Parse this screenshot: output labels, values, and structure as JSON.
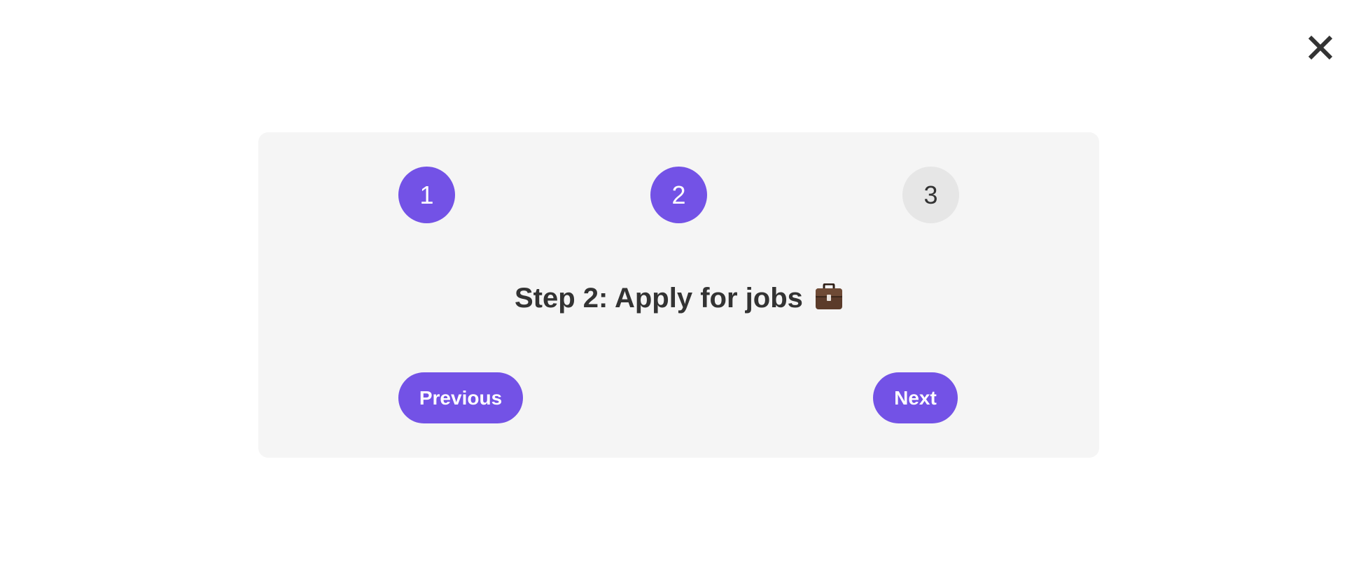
{
  "close": {
    "icon": "close-icon"
  },
  "stepper": {
    "current": 2,
    "steps": [
      {
        "label": "1",
        "state": "completed"
      },
      {
        "label": "2",
        "state": "active"
      },
      {
        "label": "3",
        "state": "inactive"
      }
    ]
  },
  "content": {
    "title": "Step 2: Apply for jobs",
    "title_icon": "briefcase-icon"
  },
  "nav": {
    "previous_label": "Previous",
    "next_label": "Next"
  },
  "colors": {
    "accent": "#7352e6",
    "inactive": "#e6e6e6",
    "card_bg": "#f5f5f5",
    "text": "#333333"
  }
}
